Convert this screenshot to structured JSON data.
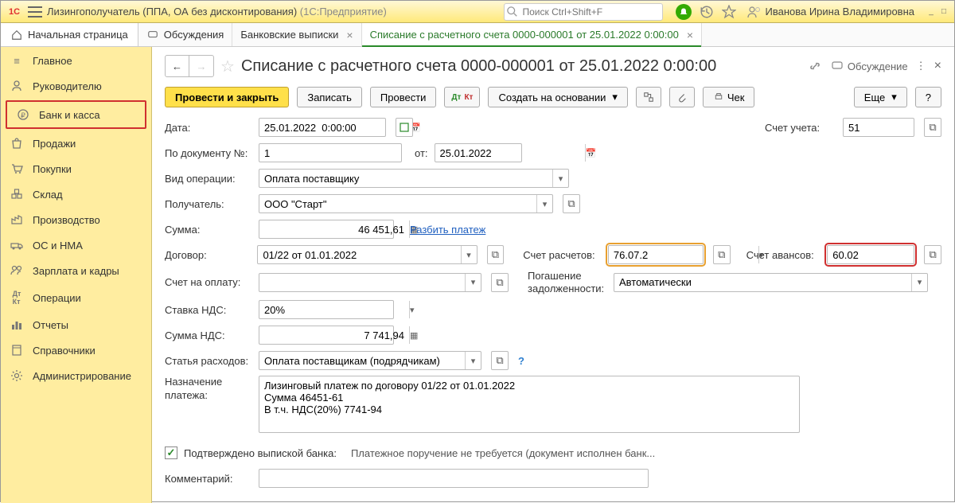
{
  "titlebar": {
    "app_title": "Лизингополучатель (ППА, ОА без дисконтирования)",
    "app_suffix": " (1С:Предприятие)",
    "search_placeholder": "Поиск Ctrl+Shift+F",
    "user_name": "Иванова Ирина Владимировна"
  },
  "tabs": {
    "home": "Начальная страница",
    "items": [
      {
        "label": "Обсуждения"
      },
      {
        "label": "Банковские выписки"
      },
      {
        "label": "Списание с расчетного счета 0000-000001 от 25.01.2022 0:00:00",
        "active": true
      }
    ]
  },
  "sidebar": [
    {
      "label": "Главное"
    },
    {
      "label": "Руководителю"
    },
    {
      "label": "Банк и касса",
      "highlight": true
    },
    {
      "label": "Продажи"
    },
    {
      "label": "Покупки"
    },
    {
      "label": "Склад"
    },
    {
      "label": "Производство"
    },
    {
      "label": "ОС и НМА"
    },
    {
      "label": "Зарплата и кадры"
    },
    {
      "label": "Операции"
    },
    {
      "label": "Отчеты"
    },
    {
      "label": "Справочники"
    },
    {
      "label": "Администрирование"
    }
  ],
  "doc": {
    "title": "Списание с расчетного счета 0000-000001 от 25.01.2022 0:00:00",
    "discussion": "Обсуждение"
  },
  "toolbar": {
    "post_close": "Провести и закрыть",
    "save": "Записать",
    "post": "Провести",
    "create_based": "Создать на основании",
    "check": "Чек",
    "more": "Еще",
    "help": "?"
  },
  "form": {
    "date_label": "Дата:",
    "date_value": "25.01.2022  0:00:00",
    "account_label": "Счет учета:",
    "account_value": "51",
    "docnum_label": "По документу №:",
    "docnum_value": "1",
    "docnum_from": "от:",
    "docnum_date": "25.01.2022",
    "op_label": "Вид операции:",
    "op_value": "Оплата поставщику",
    "recipient_label": "Получатель:",
    "recipient_value": "ООО \"Старт\"",
    "sum_label": "Сумма:",
    "sum_value": "46 451,61",
    "split_link": "Разбить платеж",
    "contract_label": "Договор:",
    "contract_value": "01/22 от 01.01.2022",
    "settle_acc_label": "Счет расчетов:",
    "settle_acc_value": "76.07.2",
    "advance_acc_label": "Счет авансов:",
    "advance_acc_value": "60.02",
    "pay_acc_label": "Счет на оплату:",
    "pay_acc_value": "",
    "debt_label": "Погашение задолженности:",
    "debt_value": "Автоматически",
    "vat_rate_label": "Ставка НДС:",
    "vat_rate_value": "20%",
    "vat_sum_label": "Сумма НДС:",
    "vat_sum_value": "7 741,94",
    "expense_label": "Статья расходов:",
    "expense_value": "Оплата поставщикам (подрядчикам)",
    "purpose_label": "Назначение платежа:",
    "purpose_value": "Лизинговый платеж по договору 01/22 от 01.01.2022\nСумма 46451-61\nВ т.ч. НДС(20%) 7741-94",
    "confirmed_label": "Подтверждено выпиской банка:",
    "confirmed_hint": "Платежное поручение не требуется (документ исполнен банк...",
    "comment_label": "Комментарий:",
    "comment_value": ""
  }
}
